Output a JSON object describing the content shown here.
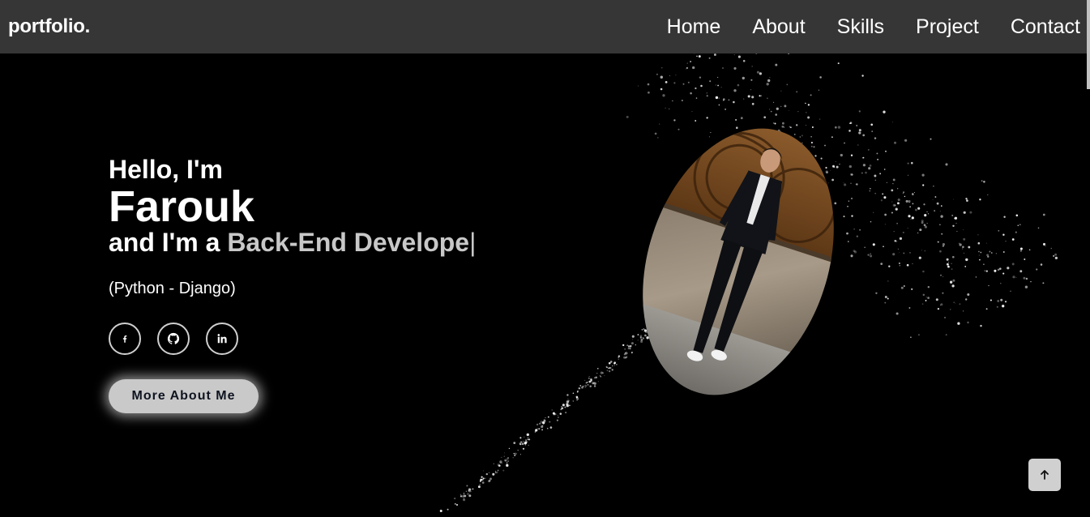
{
  "nav": {
    "logo": "portfolio.",
    "links": [
      "Home",
      "About",
      "Skills",
      "Project",
      "Contact"
    ]
  },
  "hero": {
    "greeting": "Hello, I'm",
    "name": "Farouk",
    "role_prefix": "and I'm a ",
    "role_typed": "Back-End Develope",
    "cursor": "|",
    "tech": "(Python - Django)",
    "socials": [
      "facebook-icon",
      "github-icon",
      "linkedin-icon"
    ],
    "button_label": "More About Me"
  },
  "scroll_top_icon": "arrow-up-icon",
  "colors": {
    "background": "#000000",
    "navbar": "#363636",
    "accent": "#c9c9c9",
    "button_text": "#0f1420"
  }
}
